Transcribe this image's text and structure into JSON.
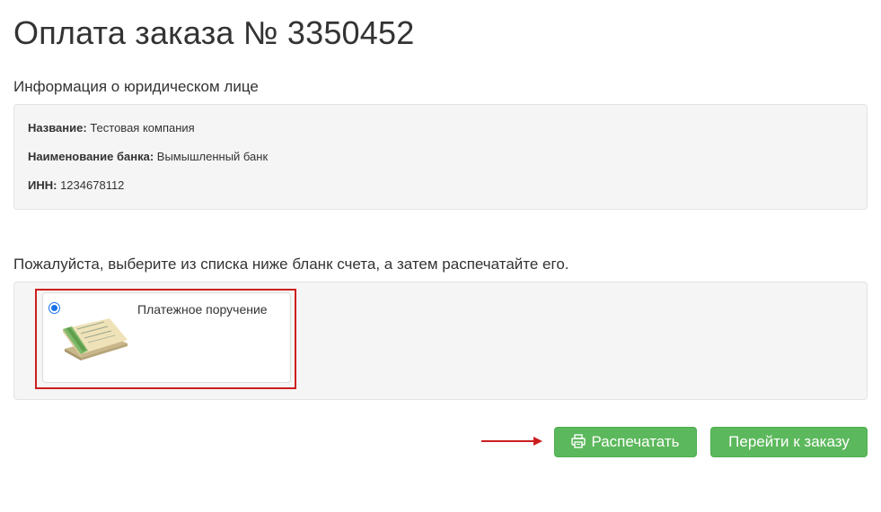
{
  "page": {
    "title": "Оплата заказа № 3350452"
  },
  "legal_entity": {
    "section_title": "Информация о юридическом лице",
    "rows": [
      {
        "label": "Название:",
        "value": "Тестовая компания"
      },
      {
        "label": "Наименование банка:",
        "value": "Вымышленный банк"
      },
      {
        "label": "ИНН:",
        "value": "1234678112"
      }
    ]
  },
  "invoice_forms": {
    "instruction": "Пожалуйста, выберите из списка ниже бланк счета, а затем распечатайте его.",
    "options": [
      {
        "label": "Платежное поручение",
        "selected": true,
        "icon": "payment-order-document-icon"
      }
    ]
  },
  "actions": {
    "print_label": "Распечатать",
    "print_icon": "printer-icon",
    "go_to_order_label": "Перейти к заказу"
  },
  "colors": {
    "button_green": "#5cb85c",
    "highlight_red": "#cc1f1f",
    "radio_blue": "#1a73e8"
  }
}
